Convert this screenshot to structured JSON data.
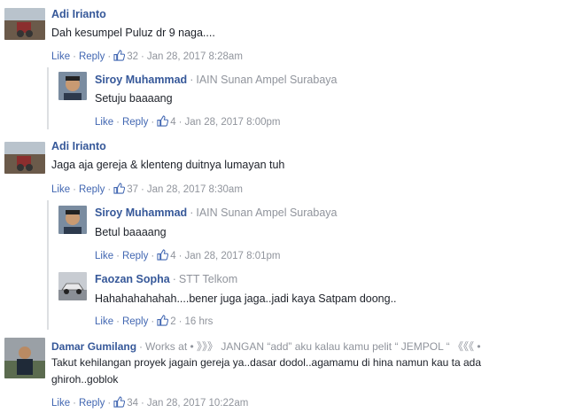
{
  "actions": {
    "like": "Like",
    "reply": "Reply",
    "dot": "·"
  },
  "colors": {
    "link": "#365899",
    "action_link": "#4267b2",
    "meta": "#90949c",
    "text": "#1d2129",
    "reply_line": "#dddfe2"
  },
  "comments": [
    {
      "name": "Adi Irianto",
      "affiliation": "",
      "text": "Dah kesumpel Puluz dr 9 naga....",
      "likes": "32",
      "time": "Jan 28, 2017 8:28am",
      "avatar": "landscape-avatar"
    },
    {
      "name": "Siroy Muhammad",
      "affiliation": "IAIN Sunan Ampel Surabaya",
      "text": "Setuju baaaang",
      "likes": "4",
      "time": "Jan 28, 2017 8:00pm",
      "avatar": "portrait-avatar"
    },
    {
      "name": "Adi Irianto",
      "affiliation": "",
      "text": "Jaga aja gereja & klenteng duitnya lumayan tuh",
      "likes": "37",
      "time": "Jan 28, 2017 8:30am",
      "avatar": "landscape-avatar"
    },
    {
      "name": "Siroy Muhammad",
      "affiliation": "IAIN Sunan Ampel Surabaya",
      "text": "Betul baaaang",
      "likes": "4",
      "time": "Jan 28, 2017 8:01pm",
      "avatar": "portrait-avatar"
    },
    {
      "name": "Faozan Sopha",
      "affiliation": "STT Telkom",
      "text": "Hahahahahahah....bener juga jaga..jadi kaya Satpam doong..",
      "likes": "2",
      "time": "16 hrs",
      "avatar": "car-avatar"
    },
    {
      "name": "Damar Gumilang",
      "affiliation": "Works at • 》》》 JANGAN “add” aku kalau kamu pelit “ JEMPOL “ 《《《 •",
      "text_line1": "Takut kehilangan proyek jagain gereja ya..dasar dodol..agamamu di hina namun kau ta ada",
      "text_line2": "ghiroh..goblok",
      "likes": "34",
      "time": "Jan 28, 2017 10:22am",
      "avatar": "person-avatar"
    }
  ]
}
